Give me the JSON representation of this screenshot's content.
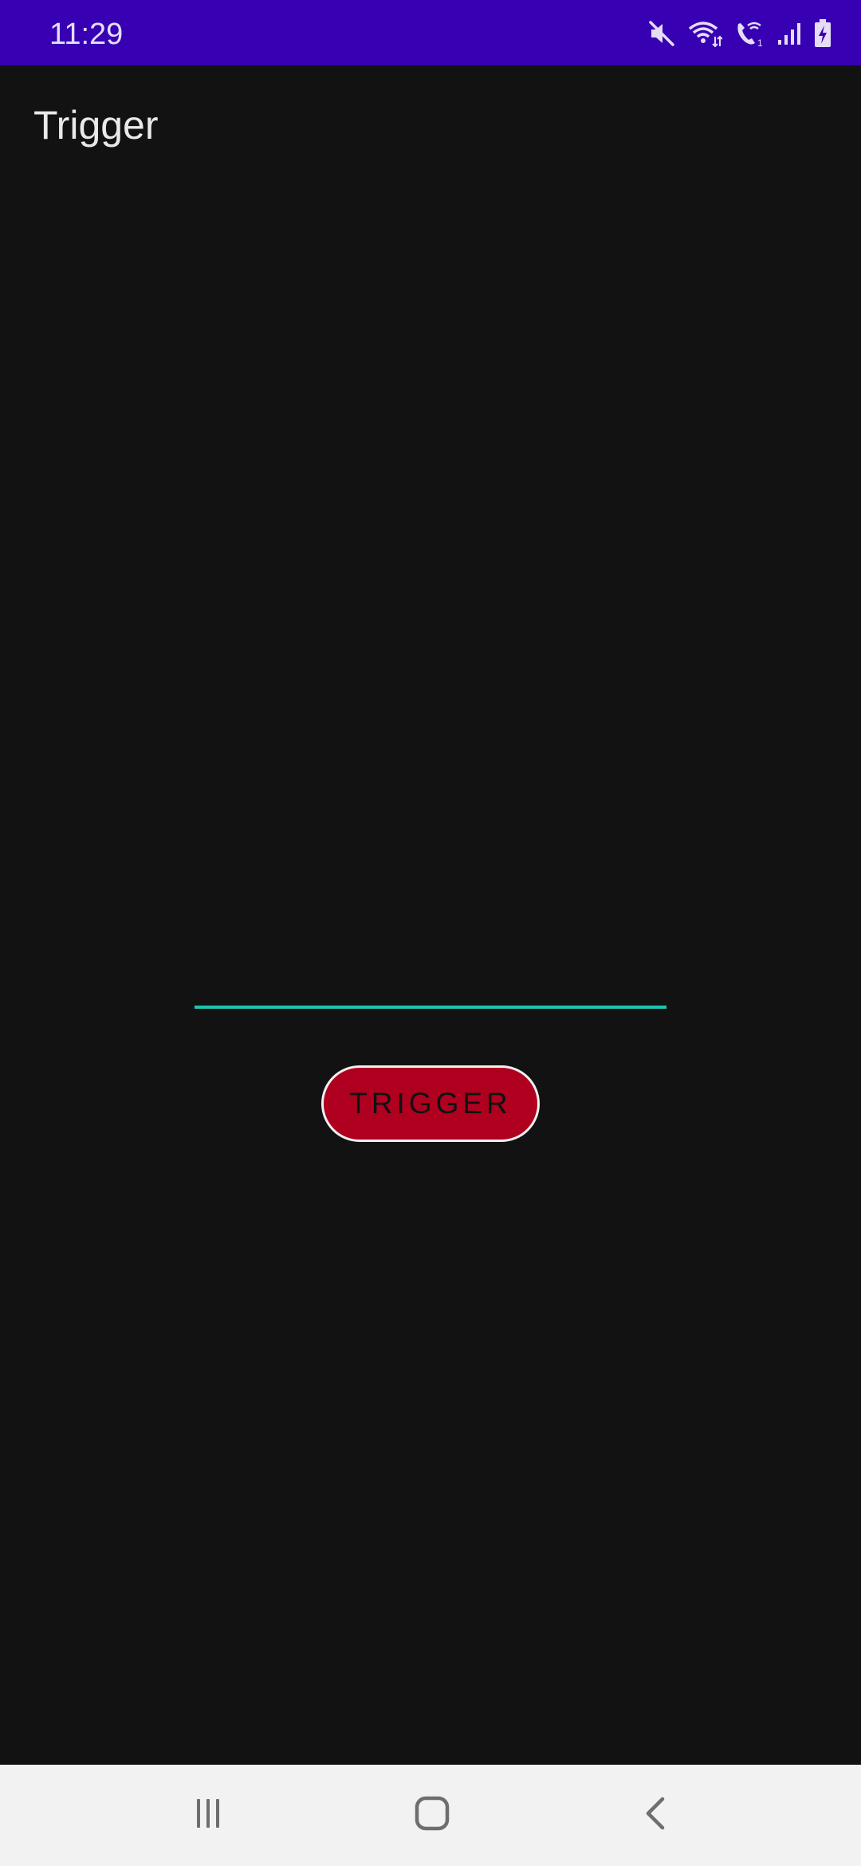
{
  "status_bar": {
    "time": "11:29",
    "background_color": "#3700b3",
    "icons": [
      "mute-icon",
      "wifi-icon",
      "wifi-calling-icon",
      "signal-icon",
      "battery-charging-icon"
    ]
  },
  "app": {
    "title": "Trigger"
  },
  "main": {
    "input": {
      "value": "",
      "placeholder": "",
      "underline_color": "#1bc6b0"
    },
    "trigger_button": {
      "label": "TRIGGER",
      "background_color": "#b00020",
      "border_color": "#f0f0f0"
    }
  },
  "nav_bar": {
    "icons": [
      "recents-icon",
      "home-icon",
      "back-icon"
    ]
  },
  "colors": {
    "background": "#121212",
    "accent": "#1bc6b0"
  }
}
